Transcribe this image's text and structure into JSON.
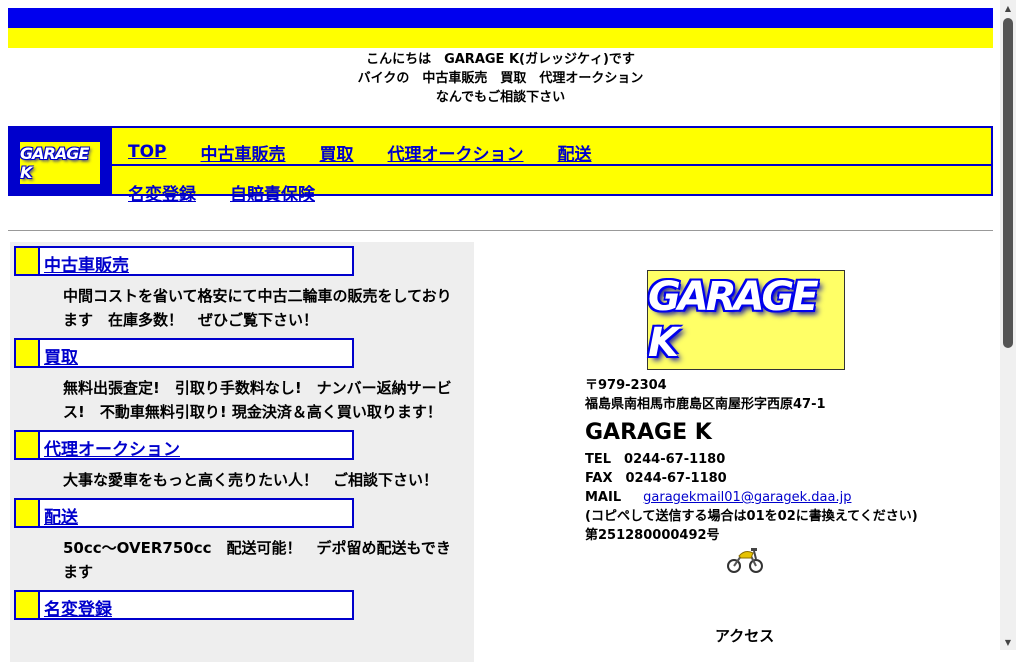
{
  "greeting": {
    "line1": "こんにちは　GARAGE K(ガレッジケィ)です",
    "line2": "バイクの　中古車販売　買取　代理オークション",
    "line3": "なんでもご相談下さい"
  },
  "logo_text": "GARAGE K",
  "nav": {
    "row1": [
      "TOP",
      "中古車販売",
      "買取",
      "代理オークション",
      "配送"
    ],
    "row2": [
      "名変登録",
      "自賠責保険"
    ]
  },
  "sections": [
    {
      "title": "中古車販売",
      "desc": "中間コストを省いて格安にて中古二輪車の販売をしております　在庫多数！　ぜひご覧下さい！"
    },
    {
      "title": "買取",
      "desc": "無料出張査定!　引取り手数料なし!　ナンバー返納サービス!　不動車無料引取り! 現金決済＆高く買い取ります！"
    },
    {
      "title": "代理オークション",
      "desc": "大事な愛車をもっと高く売りたい人！　ご相談下さい！"
    },
    {
      "title": "配送",
      "desc": "50cc～OVER750cc　配送可能！　デポ留め配送もできます"
    },
    {
      "title": "名変登録",
      "desc": ""
    }
  ],
  "company": {
    "postal": "〒979-2304",
    "address": "福島県南相馬市鹿島区南屋形字西原47-1",
    "name": "GARAGE K",
    "tel": "TEL　0244-67-1180",
    "fax": "FAX　0244-67-1180",
    "mail_label": "MAIL",
    "mail": "garagekmail01@garagek.daa.jp",
    "mail_note": "(コピペして送信する場合は01を02に書換えてください)",
    "license": "第251280000492号",
    "access": "アクセス"
  },
  "colors": {
    "blue": "#0000ee",
    "yellow": "#ffff00",
    "link": "#0000cc"
  }
}
